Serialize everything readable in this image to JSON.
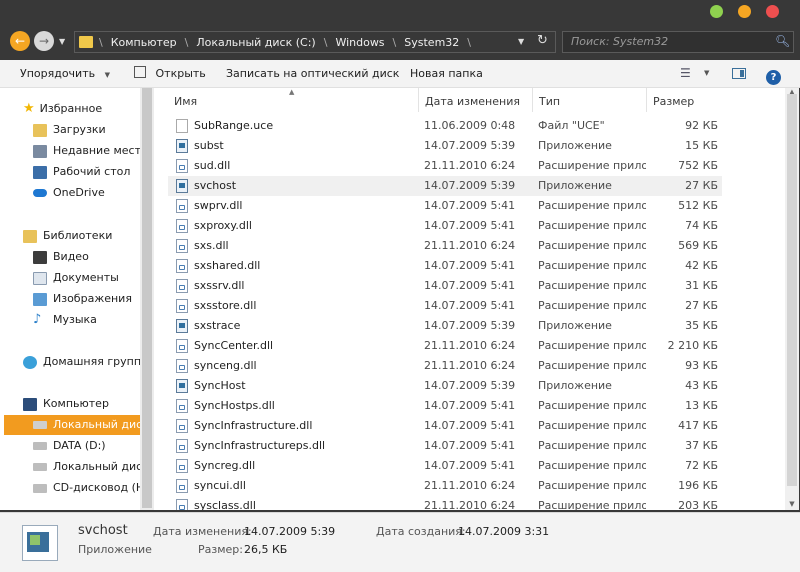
{
  "nav": {
    "breadcrumbs": [
      "Компьютер",
      "Локальный диск (C:)",
      "Windows",
      "System32"
    ],
    "search_placeholder": "Поиск: System32"
  },
  "toolbar": {
    "organize": "Упорядочить",
    "open": "Открыть",
    "burn": "Записать на оптический диск",
    "new_folder": "Новая папка"
  },
  "sidebar": {
    "favorites": "Избранное",
    "fav_items": [
      "Загрузки",
      "Недавние места",
      "Рабочий стол",
      "OneDrive"
    ],
    "libraries": "Библиотеки",
    "lib_items": [
      "Видео",
      "Документы",
      "Изображения",
      "Музыка"
    ],
    "homegroup": "Домашняя группа",
    "computer": "Компьютер",
    "comp_items": [
      "Локальный диск (C:)",
      "DATA (D:)",
      "Локальный диск",
      "CD-дисковод (H:)"
    ]
  },
  "columns": {
    "name": "Имя",
    "date": "Дата изменения",
    "type": "Тип",
    "size": "Размер"
  },
  "files": [
    {
      "name": "SubRange.uce",
      "date": "11.06.2009 0:48",
      "type": "Файл \"UCE\"",
      "size": "92 КБ",
      "kind": "uce"
    },
    {
      "name": "subst",
      "date": "14.07.2009 5:39",
      "type": "Приложение",
      "size": "15 КБ",
      "kind": "exe"
    },
    {
      "name": "sud.dll",
      "date": "21.11.2010 6:24",
      "type": "Расширение приложения",
      "size": "752 КБ",
      "kind": "dll"
    },
    {
      "name": "svchost",
      "date": "14.07.2009 5:39",
      "type": "Приложение",
      "size": "27 КБ",
      "kind": "exe"
    },
    {
      "name": "swprv.dll",
      "date": "14.07.2009 5:41",
      "type": "Расширение приложения",
      "size": "512 КБ",
      "kind": "dll"
    },
    {
      "name": "sxproxy.dll",
      "date": "14.07.2009 5:41",
      "type": "Расширение приложения",
      "size": "74 КБ",
      "kind": "dll"
    },
    {
      "name": "sxs.dll",
      "date": "21.11.2010 6:24",
      "type": "Расширение приложения",
      "size": "569 КБ",
      "kind": "dll"
    },
    {
      "name": "sxshared.dll",
      "date": "14.07.2009 5:41",
      "type": "Расширение приложения",
      "size": "42 КБ",
      "kind": "dll"
    },
    {
      "name": "sxssrv.dll",
      "date": "14.07.2009 5:41",
      "type": "Расширение приложения",
      "size": "31 КБ",
      "kind": "dll"
    },
    {
      "name": "sxsstore.dll",
      "date": "14.07.2009 5:41",
      "type": "Расширение приложения",
      "size": "27 КБ",
      "kind": "dll"
    },
    {
      "name": "sxstrace",
      "date": "14.07.2009 5:39",
      "type": "Приложение",
      "size": "35 КБ",
      "kind": "exe"
    },
    {
      "name": "SyncCenter.dll",
      "date": "21.11.2010 6:24",
      "type": "Расширение приложения",
      "size": "2 210 КБ",
      "kind": "dll"
    },
    {
      "name": "synceng.dll",
      "date": "21.11.2010 6:24",
      "type": "Расширение приложения",
      "size": "93 КБ",
      "kind": "dll"
    },
    {
      "name": "SyncHost",
      "date": "14.07.2009 5:39",
      "type": "Приложение",
      "size": "43 КБ",
      "kind": "exe"
    },
    {
      "name": "SyncHostps.dll",
      "date": "14.07.2009 5:41",
      "type": "Расширение приложения",
      "size": "13 КБ",
      "kind": "dll"
    },
    {
      "name": "SyncInfrastructure.dll",
      "date": "14.07.2009 5:41",
      "type": "Расширение приложения",
      "size": "417 КБ",
      "kind": "dll"
    },
    {
      "name": "SyncInfrastructureps.dll",
      "date": "14.07.2009 5:41",
      "type": "Расширение приложения",
      "size": "37 КБ",
      "kind": "dll"
    },
    {
      "name": "Syncreg.dll",
      "date": "14.07.2009 5:41",
      "type": "Расширение приложения",
      "size": "72 КБ",
      "kind": "dll"
    },
    {
      "name": "syncui.dll",
      "date": "21.11.2010 6:24",
      "type": "Расширение приложения",
      "size": "196 КБ",
      "kind": "dll"
    },
    {
      "name": "sysclass.dll",
      "date": "21.11.2010 6:24",
      "type": "Расширение приложения",
      "size": "203 КБ",
      "kind": "dll"
    }
  ],
  "selected_index": 3,
  "details": {
    "name": "svchost",
    "type": "Приложение",
    "modified_label": "Дата изменения:",
    "modified_value": "14.07.2009 5:39",
    "created_label": "Дата создания:",
    "created_value": "14.07.2009 3:31",
    "size_label": "Размер:",
    "size_value": "26,5 КБ"
  },
  "colors": {
    "accent": "#f29b1f",
    "close": "#ee4f4f",
    "minimize": "#f5a623",
    "maximize": "#8fd14f"
  }
}
